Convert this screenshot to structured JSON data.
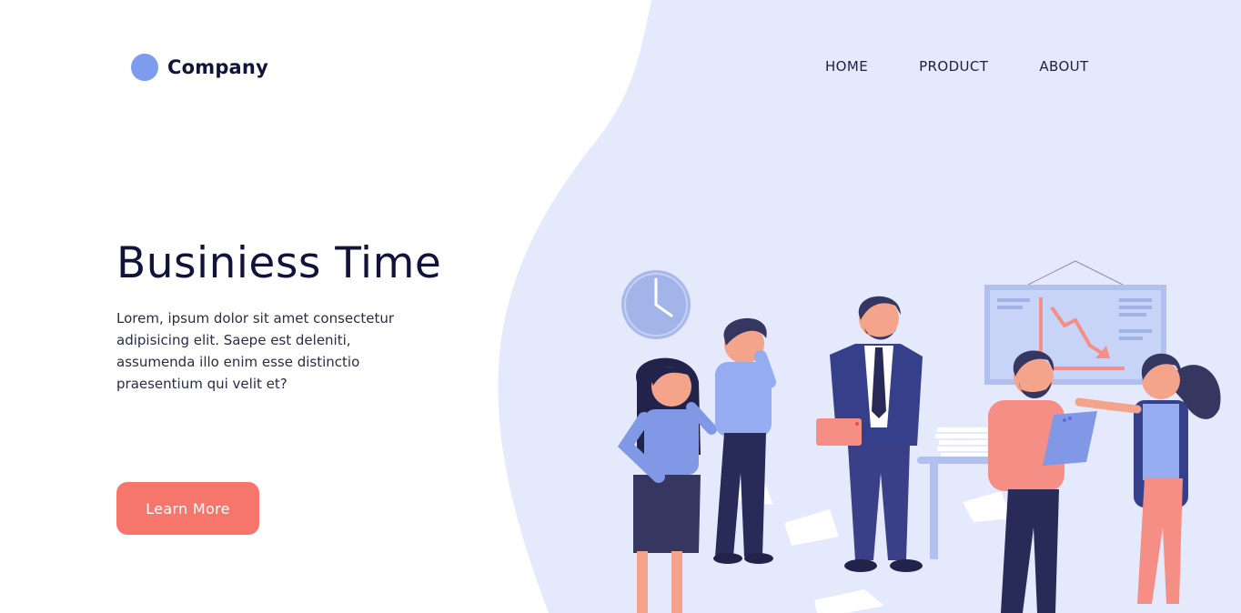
{
  "brand": {
    "name": "Company",
    "dot_color": "#7d9cf0"
  },
  "nav": {
    "items": [
      "HOME",
      "PRODUCT",
      "ABOUT"
    ]
  },
  "hero": {
    "title": "Businiess Time",
    "body": "Lorem, ipsum dolor sit amet consectetur adipisicing elit. Saepe est deleniti, assumenda illo enim esse distinctio praesentium qui velit et?",
    "cta": "Learn More"
  },
  "colors": {
    "background_blob": "#e4eafc",
    "accent": "#f7766c",
    "text_dark": "#11133a"
  },
  "illustration": {
    "icons": [
      "wall-clock-icon",
      "falling-chart-board-icon",
      "office-desk-icon",
      "paper-stack-icon"
    ]
  }
}
